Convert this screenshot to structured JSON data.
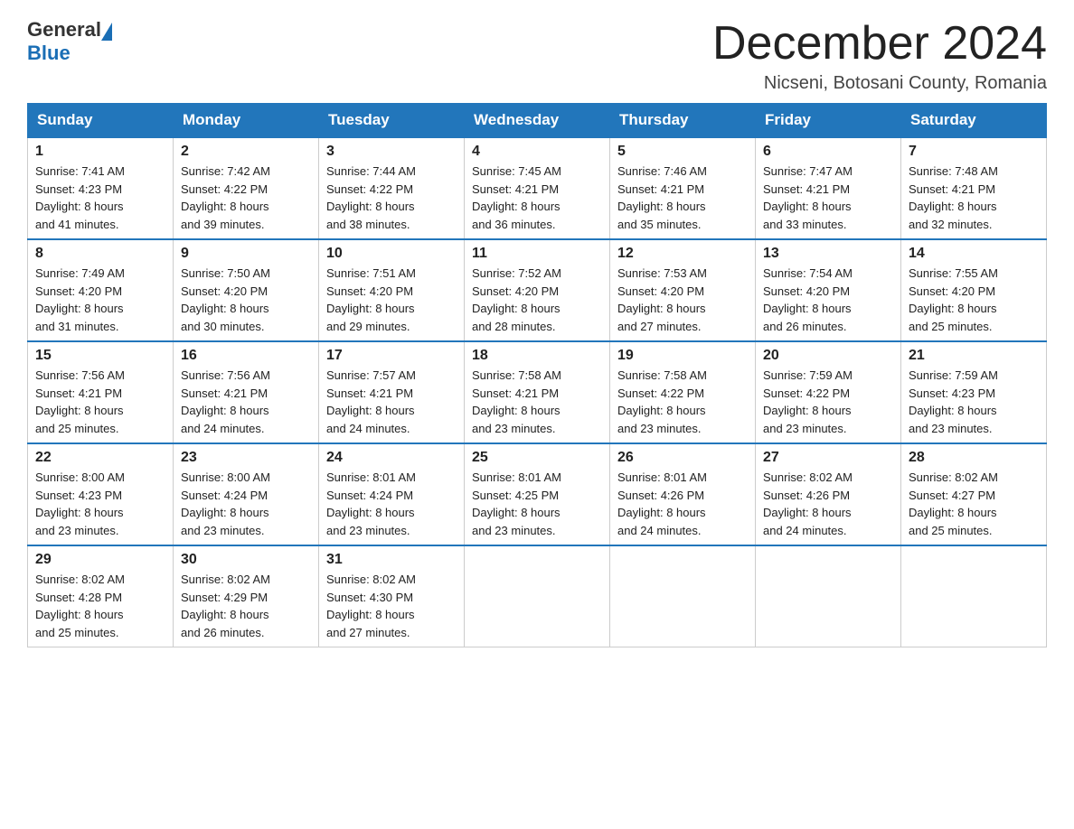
{
  "logo": {
    "text_general": "General",
    "triangle_color": "#1a6eb5",
    "text_blue": "Blue"
  },
  "title": "December 2024",
  "subtitle": "Nicseni, Botosani County, Romania",
  "days_of_week": [
    "Sunday",
    "Monday",
    "Tuesday",
    "Wednesday",
    "Thursday",
    "Friday",
    "Saturday"
  ],
  "weeks": [
    [
      {
        "day": "1",
        "sunrise": "7:41 AM",
        "sunset": "4:23 PM",
        "daylight": "8 hours and 41 minutes."
      },
      {
        "day": "2",
        "sunrise": "7:42 AM",
        "sunset": "4:22 PM",
        "daylight": "8 hours and 39 minutes."
      },
      {
        "day": "3",
        "sunrise": "7:44 AM",
        "sunset": "4:22 PM",
        "daylight": "8 hours and 38 minutes."
      },
      {
        "day": "4",
        "sunrise": "7:45 AM",
        "sunset": "4:21 PM",
        "daylight": "8 hours and 36 minutes."
      },
      {
        "day": "5",
        "sunrise": "7:46 AM",
        "sunset": "4:21 PM",
        "daylight": "8 hours and 35 minutes."
      },
      {
        "day": "6",
        "sunrise": "7:47 AM",
        "sunset": "4:21 PM",
        "daylight": "8 hours and 33 minutes."
      },
      {
        "day": "7",
        "sunrise": "7:48 AM",
        "sunset": "4:21 PM",
        "daylight": "8 hours and 32 minutes."
      }
    ],
    [
      {
        "day": "8",
        "sunrise": "7:49 AM",
        "sunset": "4:20 PM",
        "daylight": "8 hours and 31 minutes."
      },
      {
        "day": "9",
        "sunrise": "7:50 AM",
        "sunset": "4:20 PM",
        "daylight": "8 hours and 30 minutes."
      },
      {
        "day": "10",
        "sunrise": "7:51 AM",
        "sunset": "4:20 PM",
        "daylight": "8 hours and 29 minutes."
      },
      {
        "day": "11",
        "sunrise": "7:52 AM",
        "sunset": "4:20 PM",
        "daylight": "8 hours and 28 minutes."
      },
      {
        "day": "12",
        "sunrise": "7:53 AM",
        "sunset": "4:20 PM",
        "daylight": "8 hours and 27 minutes."
      },
      {
        "day": "13",
        "sunrise": "7:54 AM",
        "sunset": "4:20 PM",
        "daylight": "8 hours and 26 minutes."
      },
      {
        "day": "14",
        "sunrise": "7:55 AM",
        "sunset": "4:20 PM",
        "daylight": "8 hours and 25 minutes."
      }
    ],
    [
      {
        "day": "15",
        "sunrise": "7:56 AM",
        "sunset": "4:21 PM",
        "daylight": "8 hours and 25 minutes."
      },
      {
        "day": "16",
        "sunrise": "7:56 AM",
        "sunset": "4:21 PM",
        "daylight": "8 hours and 24 minutes."
      },
      {
        "day": "17",
        "sunrise": "7:57 AM",
        "sunset": "4:21 PM",
        "daylight": "8 hours and 24 minutes."
      },
      {
        "day": "18",
        "sunrise": "7:58 AM",
        "sunset": "4:21 PM",
        "daylight": "8 hours and 23 minutes."
      },
      {
        "day": "19",
        "sunrise": "7:58 AM",
        "sunset": "4:22 PM",
        "daylight": "8 hours and 23 minutes."
      },
      {
        "day": "20",
        "sunrise": "7:59 AM",
        "sunset": "4:22 PM",
        "daylight": "8 hours and 23 minutes."
      },
      {
        "day": "21",
        "sunrise": "7:59 AM",
        "sunset": "4:23 PM",
        "daylight": "8 hours and 23 minutes."
      }
    ],
    [
      {
        "day": "22",
        "sunrise": "8:00 AM",
        "sunset": "4:23 PM",
        "daylight": "8 hours and 23 minutes."
      },
      {
        "day": "23",
        "sunrise": "8:00 AM",
        "sunset": "4:24 PM",
        "daylight": "8 hours and 23 minutes."
      },
      {
        "day": "24",
        "sunrise": "8:01 AM",
        "sunset": "4:24 PM",
        "daylight": "8 hours and 23 minutes."
      },
      {
        "day": "25",
        "sunrise": "8:01 AM",
        "sunset": "4:25 PM",
        "daylight": "8 hours and 23 minutes."
      },
      {
        "day": "26",
        "sunrise": "8:01 AM",
        "sunset": "4:26 PM",
        "daylight": "8 hours and 24 minutes."
      },
      {
        "day": "27",
        "sunrise": "8:02 AM",
        "sunset": "4:26 PM",
        "daylight": "8 hours and 24 minutes."
      },
      {
        "day": "28",
        "sunrise": "8:02 AM",
        "sunset": "4:27 PM",
        "daylight": "8 hours and 25 minutes."
      }
    ],
    [
      {
        "day": "29",
        "sunrise": "8:02 AM",
        "sunset": "4:28 PM",
        "daylight": "8 hours and 25 minutes."
      },
      {
        "day": "30",
        "sunrise": "8:02 AM",
        "sunset": "4:29 PM",
        "daylight": "8 hours and 26 minutes."
      },
      {
        "day": "31",
        "sunrise": "8:02 AM",
        "sunset": "4:30 PM",
        "daylight": "8 hours and 27 minutes."
      },
      null,
      null,
      null,
      null
    ]
  ],
  "labels": {
    "sunrise": "Sunrise:",
    "sunset": "Sunset:",
    "daylight": "Daylight:"
  }
}
